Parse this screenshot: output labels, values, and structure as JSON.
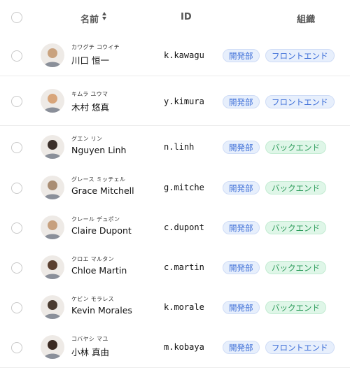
{
  "header": {
    "name_label": "名前",
    "id_label": "ID",
    "org_label": "組織",
    "sort_icon": "sort-icon"
  },
  "rows": [
    {
      "kana": "カワグチ コウイチ",
      "name": "川口 恒一",
      "id": "k.kawagu",
      "dept": "開発部",
      "team": "フロントエンド",
      "team_type": "frontend",
      "avatar_color": "#c9a27e"
    },
    {
      "kana": "キムラ ユウマ",
      "name": "木村 悠真",
      "id": "y.kimura",
      "dept": "開発部",
      "team": "フロントエンド",
      "team_type": "frontend",
      "avatar_color": "#d8a57a"
    },
    {
      "kana": "グエン リン",
      "name": "Nguyen Linh",
      "id": "n.linh",
      "dept": "開発部",
      "team": "バックエンド",
      "team_type": "backend",
      "avatar_color": "#3b2f2a"
    },
    {
      "kana": "グレース ミッチェル",
      "name": "Grace Mitchell",
      "id": "g.mitche",
      "dept": "開発部",
      "team": "バックエンド",
      "team_type": "backend",
      "avatar_color": "#a98d73"
    },
    {
      "kana": "クレール デュポン",
      "name": "Claire Dupont",
      "id": "c.dupont",
      "dept": "開発部",
      "team": "バックエンド",
      "team_type": "backend",
      "avatar_color": "#c7a07e"
    },
    {
      "kana": "クロエ マルタン",
      "name": "Chloe Martin",
      "id": "c.martin",
      "dept": "開発部",
      "team": "バックエンド",
      "team_type": "backend",
      "avatar_color": "#5a4030"
    },
    {
      "kana": "ケビン モラレス",
      "name": "Kevin Morales",
      "id": "k.morale",
      "dept": "開発部",
      "team": "バックエンド",
      "team_type": "backend",
      "avatar_color": "#4a3b30"
    },
    {
      "kana": "コバヤシ マユ",
      "name": "小林 真由",
      "id": "m.kobaya",
      "dept": "開発部",
      "team": "フロントエンド",
      "team_type": "frontend",
      "avatar_color": "#3a2a22"
    }
  ],
  "colors": {
    "frontend_tag_bg": "#e7effc",
    "frontend_tag_text": "#3e6fd8",
    "backend_tag_bg": "#dff6e8",
    "backend_tag_text": "#2a9a58"
  }
}
